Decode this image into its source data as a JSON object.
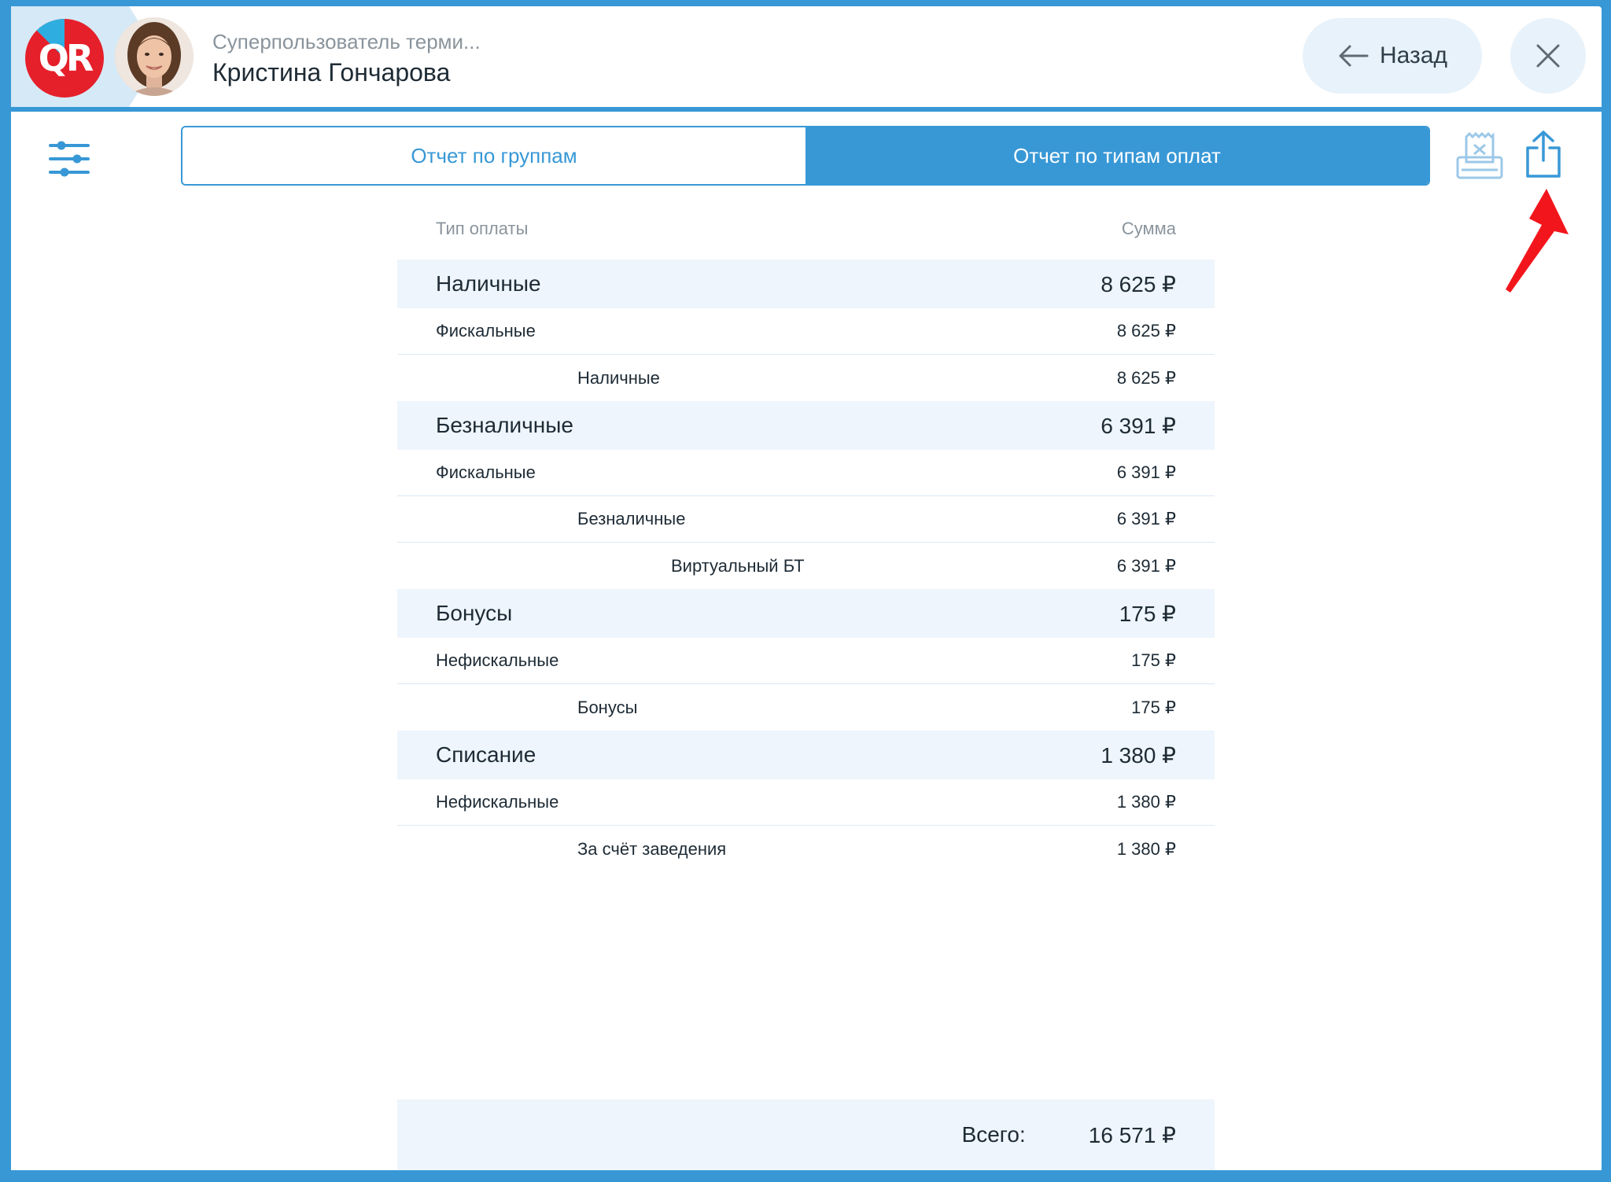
{
  "header": {
    "logo_text": "QR",
    "user_role": "Суперпользователь терми...",
    "user_name": "Кристина Гончарова",
    "back_label": "Назад",
    "back_icon": "arrow-left-icon",
    "close_icon": "close-icon"
  },
  "toolbar": {
    "filter_icon": "sliders-icon",
    "tabs": [
      {
        "label": "Отчет по группам",
        "active": false
      },
      {
        "label": "Отчет по типам оплат",
        "active": true
      }
    ],
    "print_icon": "print-receipt-icon",
    "share_icon": "share-icon",
    "annotation_icon": "red-arrow-pointer"
  },
  "table": {
    "columns": [
      "Тип оплаты",
      "Сумма"
    ],
    "rows": [
      {
        "label": "Наличные",
        "amount": "8 625 ₽",
        "level": 0
      },
      {
        "label": "Фискальные",
        "amount": "8 625 ₽",
        "level": 1
      },
      {
        "label": "Наличные",
        "amount": "8 625 ₽",
        "level": 2
      },
      {
        "label": "Безналичные",
        "amount": "6 391 ₽",
        "level": 0
      },
      {
        "label": "Фискальные",
        "amount": "6 391 ₽",
        "level": 1
      },
      {
        "label": "Безналичные",
        "amount": "6 391 ₽",
        "level": 2
      },
      {
        "label": "Виртуальный БТ",
        "amount": "6 391 ₽",
        "level": 3
      },
      {
        "label": "Бонусы",
        "amount": "175 ₽",
        "level": 0
      },
      {
        "label": "Нефискальные",
        "amount": "175 ₽",
        "level": 1
      },
      {
        "label": "Бонусы",
        "amount": "175 ₽",
        "level": 2
      },
      {
        "label": "Списание",
        "amount": "1 380 ₽",
        "level": 0
      },
      {
        "label": "Нефискальные",
        "amount": "1 380 ₽",
        "level": 1
      },
      {
        "label": "За счёт заведения",
        "amount": "1 380 ₽",
        "level": 2
      }
    ]
  },
  "total": {
    "label": "Всего:",
    "amount": "16 571 ₽"
  },
  "colors": {
    "accent": "#3898d6",
    "group_bg": "#eef5fc",
    "logo_red": "#e5202b",
    "annotation_red": "#f2161c"
  }
}
